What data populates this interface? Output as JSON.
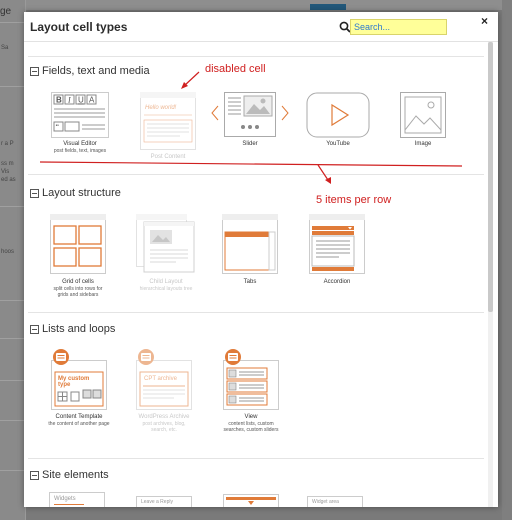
{
  "background": {
    "sidebar_title": "ge",
    "sidebar_snippets": [
      "Sa",
      "er",
      "r a P",
      "ss m",
      "Vis",
      "ed as",
      "hoos",
      "laye",
      "fault",
      "ms"
    ]
  },
  "modal": {
    "title": "Layout cell types",
    "search_placeholder": "Search...",
    "close_label": "×",
    "accent_color": "#e07b39"
  },
  "sections": {
    "fields": {
      "title": "Fields, text and media",
      "items": [
        {
          "name": "Visual Editor",
          "desc": "post fields, text, images",
          "disabled": false
        },
        {
          "name": "Post Content",
          "desc": "",
          "disabled": true,
          "preview_text": "Hello world!"
        },
        {
          "name": "Slider",
          "desc": "",
          "disabled": false
        },
        {
          "name": "YouTube",
          "desc": "",
          "disabled": false
        },
        {
          "name": "Image",
          "desc": "",
          "disabled": false
        }
      ]
    },
    "layout": {
      "title": "Layout structure",
      "items": [
        {
          "name": "Grid of cells",
          "desc": "split cells into rows for grids and sidebars",
          "disabled": false
        },
        {
          "name": "Child Layout",
          "desc": "hierarchical layouts tree",
          "disabled": true
        },
        {
          "name": "Tabs",
          "desc": "",
          "disabled": false
        },
        {
          "name": "Accordion",
          "desc": "",
          "disabled": false
        }
      ]
    },
    "lists": {
      "title": "Lists and loops",
      "items": [
        {
          "name": "Content Template",
          "desc": "the content of another page",
          "disabled": false,
          "preview_text": "My custom type"
        },
        {
          "name": "WordPress Archive",
          "desc": "post archives, blog, search, etc.",
          "disabled": true,
          "preview_text": "CPT archive"
        },
        {
          "name": "View",
          "desc": "content lists, custom searches, custom sliders",
          "disabled": false
        }
      ]
    },
    "site": {
      "title": "Site elements",
      "items": [
        {
          "name": "Widgets",
          "disabled": false
        },
        {
          "name": "Leave a Reply",
          "disabled": false
        },
        {
          "name": "Menu",
          "disabled": false
        },
        {
          "name": "Widget area",
          "disabled": false
        }
      ]
    }
  },
  "annotations": {
    "disabled_cell": "disabled cell",
    "items_per_row": "5 items per row",
    "color": "#d02020"
  }
}
